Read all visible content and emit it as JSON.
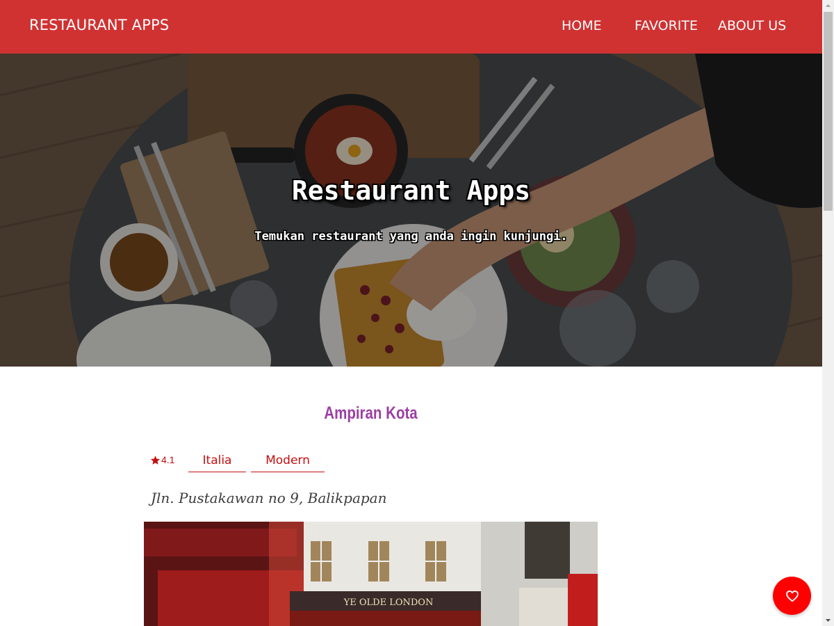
{
  "navbar": {
    "brand": "RESTAURANT APPS",
    "links": [
      {
        "label": "HOME"
      },
      {
        "label": "FAVORITE"
      },
      {
        "label": "ABOUT US"
      }
    ],
    "background_color": "#d03232"
  },
  "hero": {
    "title": "Restaurant Apps",
    "subtitle": "Temukan restaurant yang anda ingin kunjungi."
  },
  "restaurant": {
    "name": "Ampiran Kota",
    "rating": "4.1",
    "categories": [
      "Italia",
      "Modern"
    ],
    "address": "Jln. Pustakawan no 9, Balikpapan",
    "image_sign": "YE OLDE LONDON",
    "name_color": "#9c3fa3",
    "accent_color": "#c40f0f"
  },
  "fab": {
    "icon": "heart-outline-icon",
    "color": "#ff0000"
  },
  "icons": {
    "star": "star-icon",
    "heart": "heart-outline-icon"
  }
}
